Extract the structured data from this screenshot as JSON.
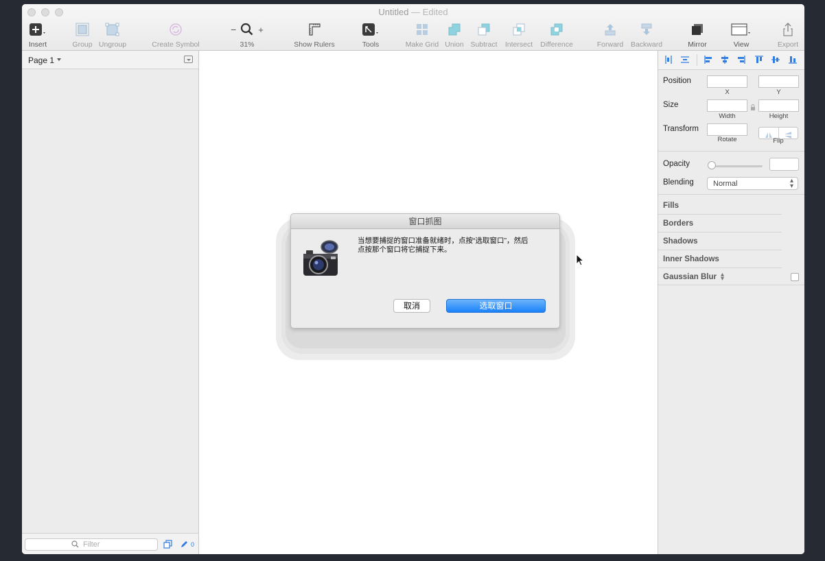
{
  "window": {
    "title": "Untitled",
    "dash": "—",
    "edited": "Edited"
  },
  "toolbar": {
    "insert": "Insert",
    "group": "Group",
    "ungroup": "Ungroup",
    "create_symbol": "Create Symbol",
    "zoom": "31%",
    "show_rulers": "Show Rulers",
    "tools": "Tools",
    "make_grid": "Make Grid",
    "union": "Union",
    "subtract": "Subtract",
    "intersect": "Intersect",
    "difference": "Difference",
    "forward": "Forward",
    "backward": "Backward",
    "mirror": "Mirror",
    "view": "View",
    "export": "Export"
  },
  "left_panel": {
    "page": "Page 1",
    "filter_placeholder": "Filter",
    "count": "0"
  },
  "dialog": {
    "title": "窗口抓图",
    "message_line1": "当想要捕捉的窗口准备就绪时，点按“选取窗口”，然后",
    "message_line2": "点按那个窗口将它捕捉下来。",
    "cancel": "取消",
    "confirm": "选取窗口"
  },
  "inspector": {
    "position": "Position",
    "x": "X",
    "y": "Y",
    "size": "Size",
    "width": "Width",
    "height": "Height",
    "transform": "Transform",
    "rotate": "Rotate",
    "flip": "Flip",
    "opacity": "Opacity",
    "blending": "Blending",
    "blending_value": "Normal",
    "fills": "Fills",
    "borders": "Borders",
    "shadows": "Shadows",
    "inner_shadows": "Inner Shadows",
    "gaussian_blur": "Gaussian Blur"
  },
  "colors": {
    "accent": "#2f7de1",
    "primary_button": "#1a82fb",
    "boolean_ops": "#8fd3e0"
  }
}
